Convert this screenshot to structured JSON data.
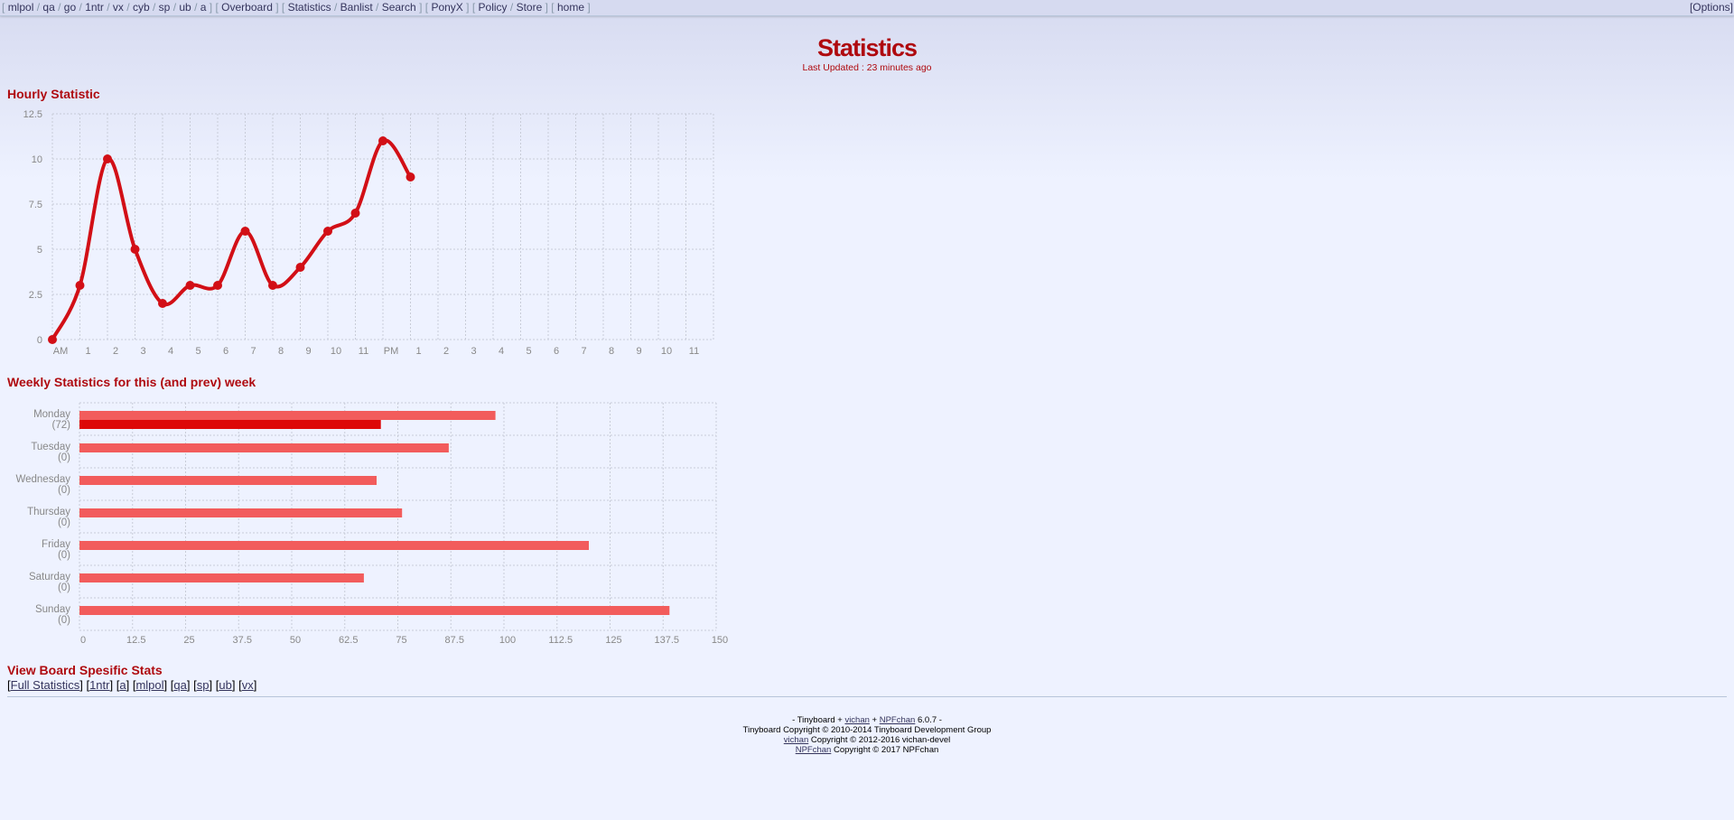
{
  "topnav": {
    "groups": [
      [
        "mlpol",
        "qa",
        "go",
        "1ntr",
        "vx",
        "cyb",
        "sp",
        "ub",
        "a"
      ],
      [
        "Overboard"
      ],
      [
        "Statistics",
        "Banlist",
        "Search"
      ],
      [
        "PonyX"
      ],
      [
        "Policy",
        "Store"
      ],
      [
        "home"
      ]
    ],
    "options_label": "[Options]"
  },
  "page": {
    "title": "Statistics",
    "last_updated": "Last Updated : 23 minutes ago"
  },
  "hourly": {
    "heading": "Hourly Statistic"
  },
  "weekly": {
    "heading": "Weekly Statistics for this (and prev) week"
  },
  "board_stats": {
    "heading": "View Board Spesific Stats",
    "links": [
      "Full Statistics",
      "1ntr",
      "a",
      "mlpol",
      "qa",
      "sp",
      "ub",
      "vx"
    ]
  },
  "footer": {
    "line1": {
      "pre": "- Tinyboard + ",
      "link1": "vichan",
      "mid": " + ",
      "link2": "NPFchan",
      "post": " 6.0.7 -"
    },
    "line2": "Tinyboard Copyright © 2010-2014 Tinyboard Development Group",
    "line3": {
      "link": "vichan",
      "text": " Copyright © 2012-2016 vichan-devel"
    },
    "line4": {
      "link": "NPFchan",
      "text": " Copyright © 2017 NPFchan"
    }
  },
  "colors": {
    "accent": "#af0a0f",
    "line": "#d20f16",
    "bar_prev": "#f25c5c",
    "bar_current": "#dd0808",
    "grid": "#c8ccd8",
    "axis_text": "#888888"
  },
  "chart_data": [
    {
      "type": "line",
      "title": "Hourly Statistic",
      "x": [
        "AM",
        "1",
        "2",
        "3",
        "4",
        "5",
        "6",
        "7",
        "8",
        "9",
        "10",
        "11",
        "PM",
        "1",
        "2",
        "3",
        "4",
        "5",
        "6",
        "7",
        "8",
        "9",
        "10",
        "11"
      ],
      "series": [
        {
          "values": [
            0,
            3,
            10,
            5,
            2,
            3,
            3,
            6,
            3,
            4,
            6,
            7,
            11,
            9
          ]
        }
      ],
      "ylim": [
        0,
        12.5
      ],
      "yticks": [
        "0",
        "2.5",
        "5",
        "7.5",
        "10",
        "12.5"
      ],
      "grid": true
    },
    {
      "type": "bar",
      "orientation": "horizontal",
      "title": "Weekly Statistics for this (and prev) week",
      "categories": [
        "Monday",
        "Tuesday",
        "Wednesday",
        "Thursday",
        "Friday",
        "Saturday",
        "Sunday"
      ],
      "category_counts": [
        "(72)",
        "(0)",
        "(0)",
        "(0)",
        "(0)",
        "(0)",
        "(0)"
      ],
      "series": [
        {
          "values": [
            98,
            87,
            70,
            76,
            120,
            67,
            139
          ]
        },
        {
          "values": [
            71,
            0,
            0,
            0,
            0,
            0,
            0
          ]
        }
      ],
      "xlim": [
        0,
        150
      ],
      "xticks": [
        "0",
        "12.5",
        "25",
        "37.5",
        "50",
        "62.5",
        "75",
        "87.5",
        "100",
        "112.5",
        "125",
        "137.5",
        "150"
      ],
      "grid": true
    }
  ]
}
